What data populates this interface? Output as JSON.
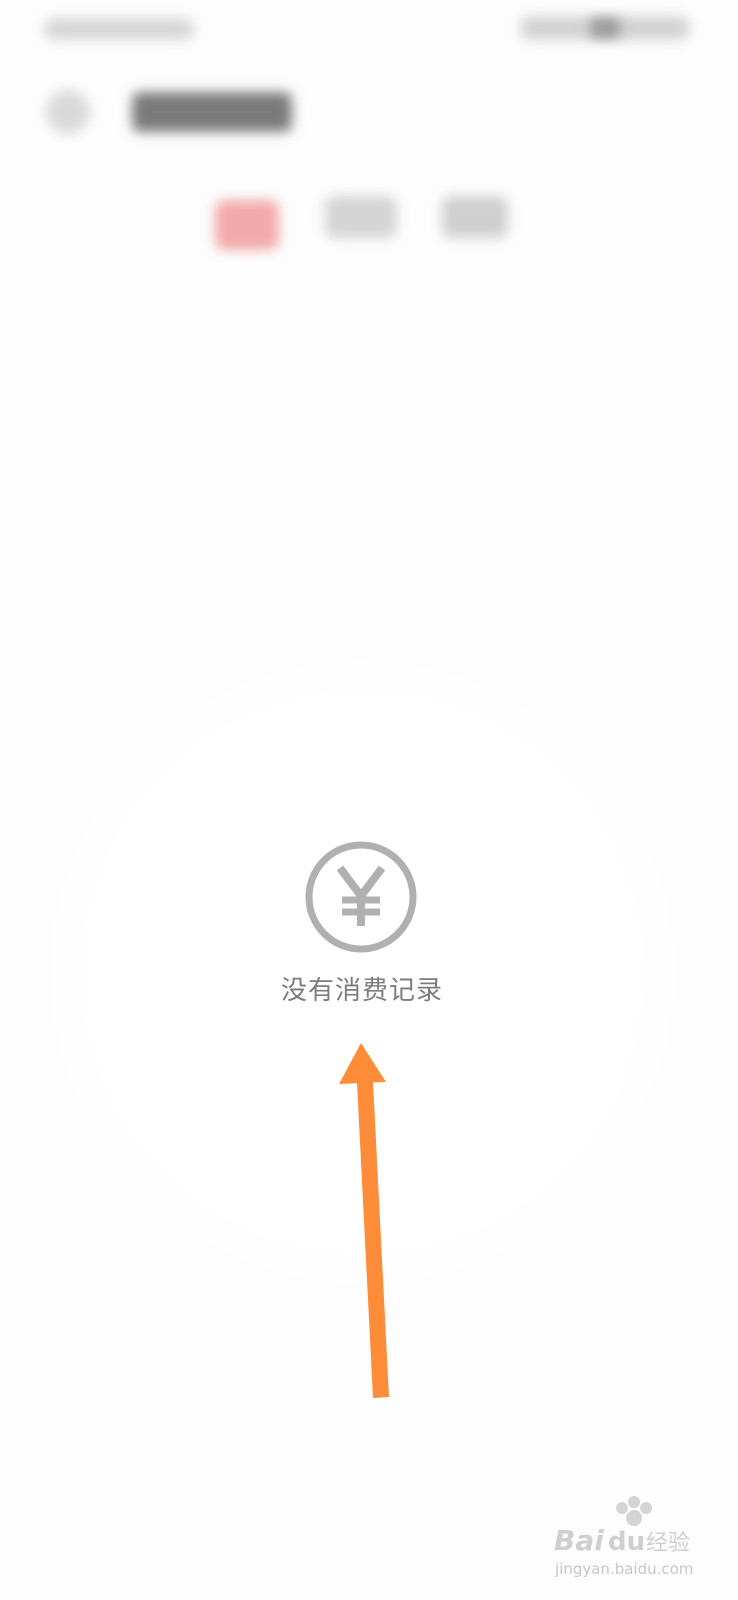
{
  "empty_state": {
    "message": "没有消费记录",
    "icon": "yen-circle-icon"
  },
  "annotation": {
    "icon": "orange-arrow-up-icon",
    "color": "#ff8c38"
  },
  "watermark": {
    "logo": "Baidu 经验",
    "url": "jingyan.baidu.com"
  },
  "colors": {
    "icon_gray": "#b0b0b0",
    "text_gray": "#7c7c7c",
    "active_tab": "#f1a9a9"
  }
}
